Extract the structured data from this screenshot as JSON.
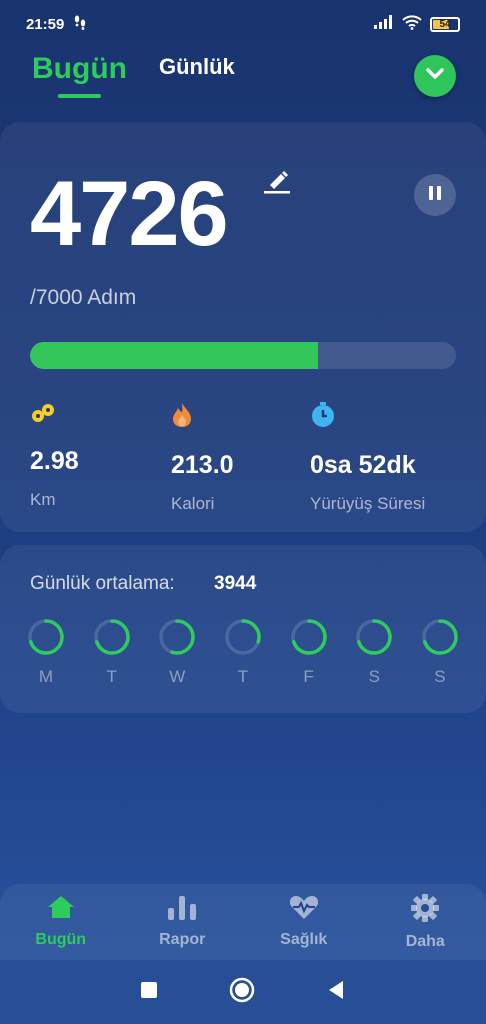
{
  "status": {
    "time": "21:59",
    "battery": "54"
  },
  "tabs": [
    {
      "label": "Bugün",
      "active": true
    },
    {
      "label": "Günlük",
      "active": false
    }
  ],
  "main": {
    "steps": "4726",
    "goal": "/7000 Adım",
    "progress": 0.675,
    "stats": [
      {
        "icon": "distance-icon",
        "value": "2.98",
        "label": "Km"
      },
      {
        "icon": "flame-icon",
        "value": "213.0",
        "label": "Kalori"
      },
      {
        "icon": "stopwatch-icon",
        "value": "0sa 52dk",
        "label": "Yürüyüş Süresi"
      }
    ]
  },
  "weekly": {
    "label": "Günlük ortalama:",
    "value": "3944",
    "days": [
      {
        "label": "M",
        "progress": 0.7
      },
      {
        "label": "T",
        "progress": 0.7
      },
      {
        "label": "W",
        "progress": 0.55
      },
      {
        "label": "T",
        "progress": 0.3
      },
      {
        "label": "F",
        "progress": 0.7
      },
      {
        "label": "S",
        "progress": 0.7
      },
      {
        "label": "S",
        "progress": 0.7
      }
    ]
  },
  "nav": [
    {
      "label": "Bugün",
      "icon": "home-icon",
      "active": true
    },
    {
      "label": "Rapor",
      "icon": "bar-chart-icon",
      "active": false
    },
    {
      "label": "Sağlık",
      "icon": "heart-pulse-icon",
      "active": false
    },
    {
      "label": "Daha",
      "icon": "gear-icon",
      "active": false
    }
  ],
  "colors": {
    "accent": "#2ecc5c",
    "progress": "#33c65a",
    "yellow": "#f5d020",
    "orange": "#f08a3c",
    "blue": "#3fb4f0"
  }
}
